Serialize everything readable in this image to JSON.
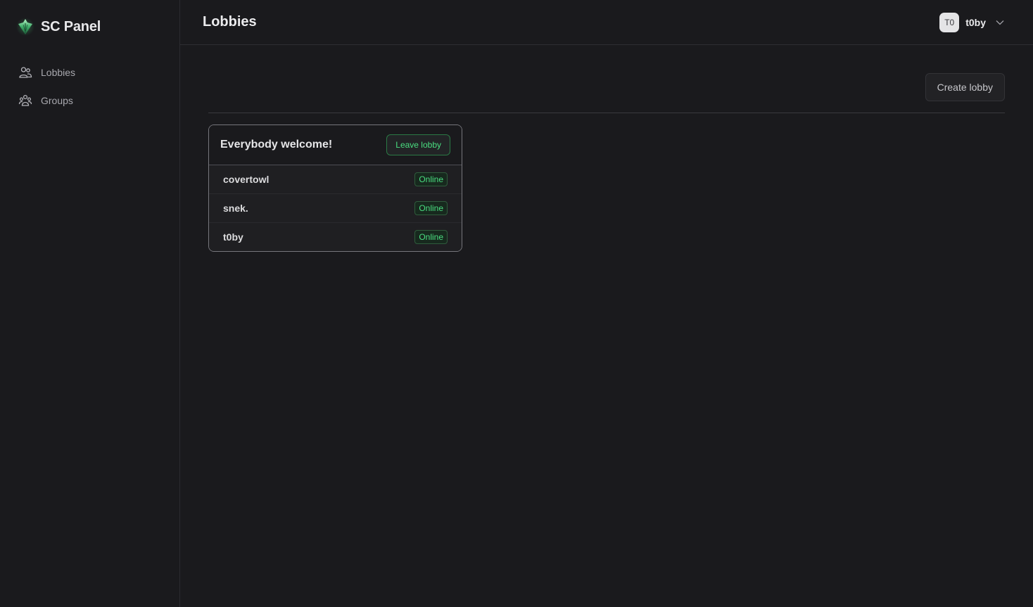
{
  "app": {
    "name": "SC Panel",
    "logo_icon": "emerald-diamond-icon",
    "accent_color": "#4ade80"
  },
  "sidebar": {
    "items": [
      {
        "label": "Lobbies",
        "icon": "users-icon"
      },
      {
        "label": "Groups",
        "icon": "group-icon"
      }
    ]
  },
  "header": {
    "title": "Lobbies",
    "user": {
      "initials": "T0",
      "name": "t0by",
      "menu_icon": "chevron-down-icon"
    }
  },
  "main": {
    "create_button_label": "Create lobby",
    "lobbies": [
      {
        "name": "Everybody welcome!",
        "leave_button_label": "Leave lobby",
        "members": [
          {
            "name": "covertowl",
            "status": "Online"
          },
          {
            "name": "snek.",
            "status": "Online"
          },
          {
            "name": "t0by",
            "status": "Online"
          }
        ]
      }
    ]
  }
}
